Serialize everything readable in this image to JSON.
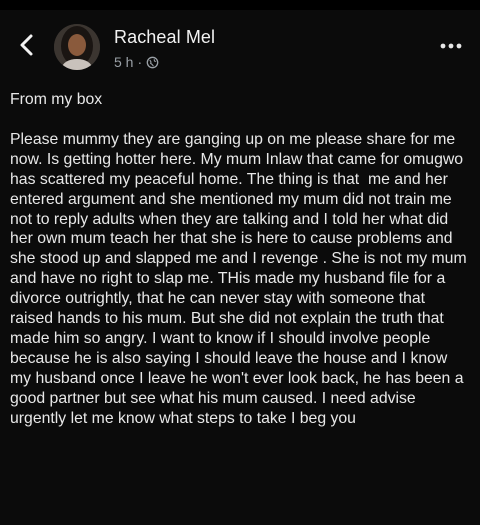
{
  "header": {
    "author_name": "Racheal Mel",
    "post_age": "5 h",
    "separator": "·",
    "back_icon": "chevron-left-icon",
    "privacy_icon": "globe-icon",
    "menu_icon": "more-horizontal-icon"
  },
  "post": {
    "line_1": "From my box",
    "body": "Please mummy they are ganging up on me please share for me now. Is getting hotter here. My mum Inlaw that came for omugwo has scattered my peaceful home. The thing is that  me and her entered argument and she mentioned my mum did not train me not to reply adults when they are talking and I told her what did her own mum teach her that she is here to cause problems and she stood up and slapped me and I revenge . She is not my mum and have no right to slap me. THis made my husband file for a divorce outrightly, that he can never stay with someone that raised hands to his mum. But she did not explain the truth that made him so angry. I want to know if I should involve people because he is also saying I should leave the house and I know my husband once I leave he won't ever look back, he has been a good partner but see what his mum caused. I need advise urgently let me know what steps to take I beg you"
  },
  "colors": {
    "background": "#0b0b0b",
    "text": "#e8e8e8",
    "meta_text": "#9aa0a6"
  }
}
